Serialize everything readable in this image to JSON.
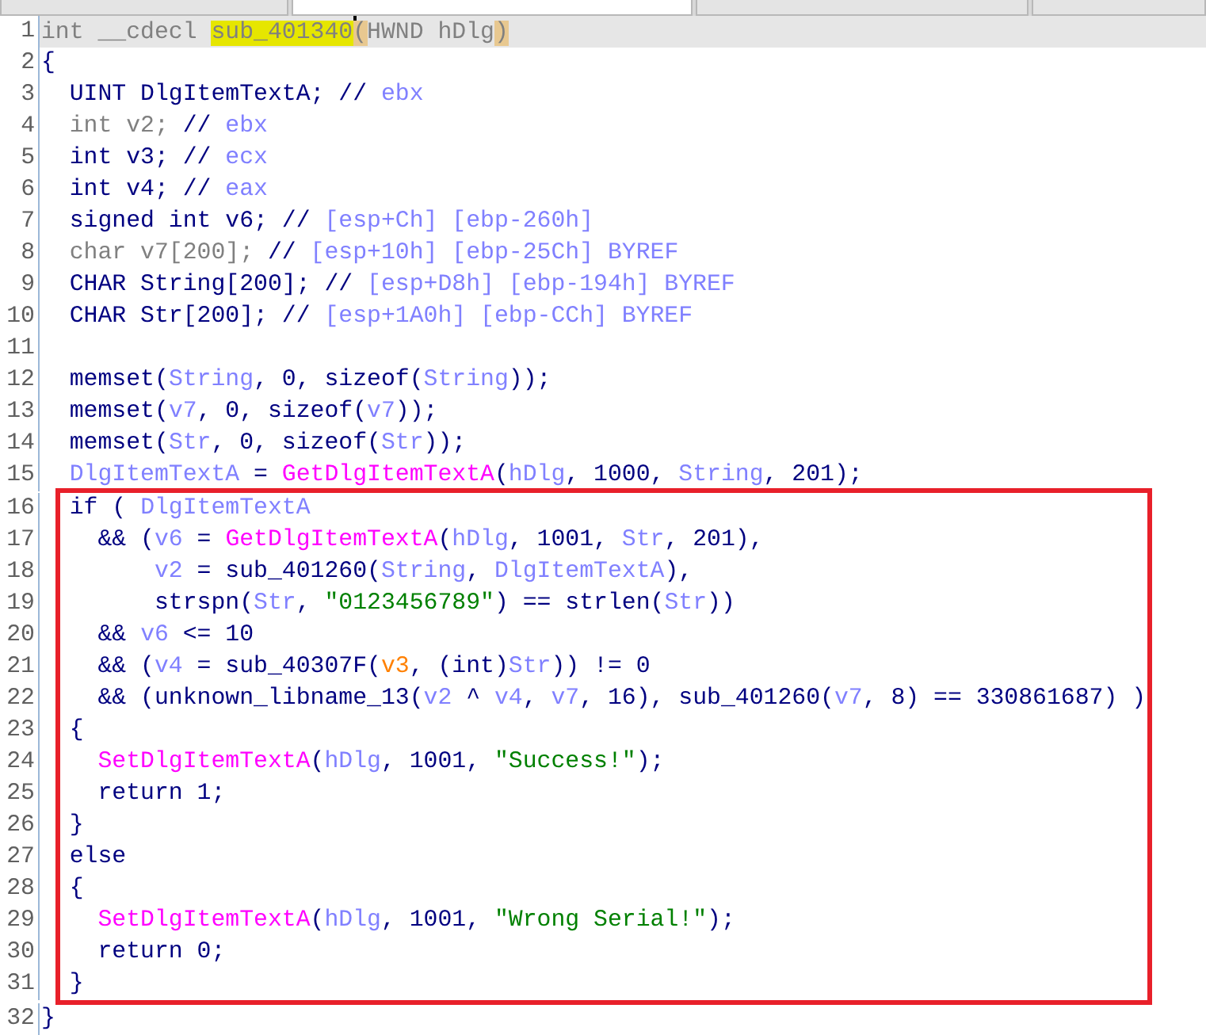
{
  "tabs": [
    {
      "selected": false
    },
    {
      "selected": true
    },
    {
      "selected": false
    },
    {
      "selected": false
    }
  ],
  "blocks": [
    {
      "boxed": false,
      "lines": [
        {
          "number": "1",
          "current": true,
          "tokens": [
            {
              "text": "int __cdecl ",
              "kind": "dim"
            },
            {
              "text": "sub_401340",
              "kind": "highlight",
              "cursor_after": true
            },
            {
              "text": "(",
              "kind": "match"
            },
            {
              "text": "HWND hDlg",
              "kind": "dim"
            },
            {
              "text": ")",
              "kind": "match"
            }
          ]
        },
        {
          "number": "2",
          "current": false,
          "tokens": [
            {
              "text": "{",
              "kind": "plain"
            }
          ]
        },
        {
          "number": "3",
          "current": false,
          "tokens": [
            {
              "text": "  UINT DlgItemTextA; // ",
              "kind": "plain"
            },
            {
              "text": "ebx",
              "kind": "var"
            }
          ]
        },
        {
          "number": "4",
          "current": false,
          "tokens": [
            {
              "text": "  int v2; ",
              "kind": "dim"
            },
            {
              "text": "// ",
              "kind": "plain"
            },
            {
              "text": "ebx",
              "kind": "var"
            }
          ]
        },
        {
          "number": "5",
          "current": false,
          "tokens": [
            {
              "text": "  int v3; // ",
              "kind": "plain"
            },
            {
              "text": "ecx",
              "kind": "var"
            }
          ]
        },
        {
          "number": "6",
          "current": false,
          "tokens": [
            {
              "text": "  int v4; // ",
              "kind": "plain"
            },
            {
              "text": "eax",
              "kind": "var"
            }
          ]
        },
        {
          "number": "7",
          "current": false,
          "tokens": [
            {
              "text": "  signed int v6; // ",
              "kind": "plain"
            },
            {
              "text": "[esp+Ch] [ebp-260h]",
              "kind": "var"
            }
          ]
        },
        {
          "number": "8",
          "current": false,
          "tokens": [
            {
              "text": "  char v7[200]; ",
              "kind": "dim"
            },
            {
              "text": "// ",
              "kind": "plain"
            },
            {
              "text": "[esp+10h] [ebp-25Ch] BYREF",
              "kind": "var"
            }
          ]
        },
        {
          "number": "9",
          "current": false,
          "tokens": [
            {
              "text": "  CHAR String[200]; // ",
              "kind": "plain"
            },
            {
              "text": "[esp+D8h] [ebp-194h] BYREF",
              "kind": "var"
            }
          ]
        },
        {
          "number": "10",
          "current": false,
          "tokens": [
            {
              "text": "  CHAR Str[200]; // ",
              "kind": "plain"
            },
            {
              "text": "[esp+1A0h] [ebp-CCh] BYREF",
              "kind": "var"
            }
          ]
        },
        {
          "number": "11",
          "current": false
        },
        {
          "number": "12",
          "current": false,
          "tokens": [
            {
              "text": "  memset(",
              "kind": "plain"
            },
            {
              "text": "String",
              "kind": "var"
            },
            {
              "text": ", 0, sizeof(",
              "kind": "plain"
            },
            {
              "text": "String",
              "kind": "var"
            },
            {
              "text": "));",
              "kind": "plain"
            }
          ]
        },
        {
          "number": "13",
          "current": false,
          "tokens": [
            {
              "text": "  memset(",
              "kind": "plain"
            },
            {
              "text": "v7",
              "kind": "var"
            },
            {
              "text": ", 0, sizeof(",
              "kind": "plain"
            },
            {
              "text": "v7",
              "kind": "var"
            },
            {
              "text": "));",
              "kind": "plain"
            }
          ]
        },
        {
          "number": "14",
          "current": false,
          "tokens": [
            {
              "text": "  memset(",
              "kind": "plain"
            },
            {
              "text": "Str",
              "kind": "var"
            },
            {
              "text": ", 0, sizeof(",
              "kind": "plain"
            },
            {
              "text": "Str",
              "kind": "var"
            },
            {
              "text": "));",
              "kind": "plain"
            }
          ]
        },
        {
          "number": "15",
          "current": false,
          "tokens": [
            {
              "text": "  DlgItemTextA",
              "kind": "var"
            },
            {
              "text": " = ",
              "kind": "plain"
            },
            {
              "text": "GetDlgItemTextA",
              "kind": "func"
            },
            {
              "text": "(",
              "kind": "plain"
            },
            {
              "text": "hDlg",
              "kind": "var"
            },
            {
              "text": ", 1000, ",
              "kind": "plain"
            },
            {
              "text": "String",
              "kind": "var"
            },
            {
              "text": ", 201);",
              "kind": "plain"
            }
          ]
        }
      ]
    },
    {
      "boxed": true,
      "lines": [
        {
          "number": "16",
          "current": false,
          "tokens": [
            {
              "text": "  if ( ",
              "kind": "plain"
            },
            {
              "text": "DlgItemTextA",
              "kind": "var"
            }
          ]
        },
        {
          "number": "17",
          "current": false,
          "tokens": [
            {
              "text": "    && (",
              "kind": "plain"
            },
            {
              "text": "v6",
              "kind": "var"
            },
            {
              "text": " = ",
              "kind": "plain"
            },
            {
              "text": "GetDlgItemTextA",
              "kind": "func"
            },
            {
              "text": "(",
              "kind": "plain"
            },
            {
              "text": "hDlg",
              "kind": "var"
            },
            {
              "text": ", 1001, ",
              "kind": "plain"
            },
            {
              "text": "Str",
              "kind": "var"
            },
            {
              "text": ", 201),",
              "kind": "plain"
            }
          ]
        },
        {
          "number": "18",
          "current": false,
          "tokens": [
            {
              "text": "        v2",
              "kind": "var"
            },
            {
              "text": " = sub_401260(",
              "kind": "plain"
            },
            {
              "text": "String",
              "kind": "var"
            },
            {
              "text": ", ",
              "kind": "plain"
            },
            {
              "text": "DlgItemTextA",
              "kind": "var"
            },
            {
              "text": "),",
              "kind": "plain"
            }
          ]
        },
        {
          "number": "19",
          "current": false,
          "tokens": [
            {
              "text": "        strspn(",
              "kind": "plain"
            },
            {
              "text": "Str",
              "kind": "var"
            },
            {
              "text": ", ",
              "kind": "plain"
            },
            {
              "text": "\"0123456789\"",
              "kind": "str"
            },
            {
              "text": ") == strlen(",
              "kind": "plain"
            },
            {
              "text": "Str",
              "kind": "var"
            },
            {
              "text": "))",
              "kind": "plain"
            }
          ]
        },
        {
          "number": "20",
          "current": false,
          "tokens": [
            {
              "text": "    && ",
              "kind": "plain"
            },
            {
              "text": "v6",
              "kind": "var"
            },
            {
              "text": " <= 10",
              "kind": "plain"
            }
          ]
        },
        {
          "number": "21",
          "current": false,
          "tokens": [
            {
              "text": "    && (",
              "kind": "plain"
            },
            {
              "text": "v4",
              "kind": "var"
            },
            {
              "text": " = sub_40307F(",
              "kind": "plain"
            },
            {
              "text": "v3",
              "kind": "orange"
            },
            {
              "text": ", (int)",
              "kind": "plain"
            },
            {
              "text": "Str",
              "kind": "var"
            },
            {
              "text": ")) != 0",
              "kind": "plain"
            }
          ]
        },
        {
          "number": "22",
          "current": false,
          "tokens": [
            {
              "text": "    && (unknown_libname_13(",
              "kind": "plain"
            },
            {
              "text": "v2",
              "kind": "var"
            },
            {
              "text": " ^ ",
              "kind": "plain"
            },
            {
              "text": "v4",
              "kind": "var"
            },
            {
              "text": ", ",
              "kind": "plain"
            },
            {
              "text": "v7",
              "kind": "var"
            },
            {
              "text": ", 16), sub_401260(",
              "kind": "plain"
            },
            {
              "text": "v7",
              "kind": "var"
            },
            {
              "text": ", 8) == 330861687) )",
              "kind": "plain"
            }
          ]
        },
        {
          "number": "23",
          "current": false,
          "tokens": [
            {
              "text": "  {",
              "kind": "plain"
            }
          ]
        },
        {
          "number": "24",
          "current": false,
          "tokens": [
            {
              "text": "    SetDlgItemTextA",
              "kind": "func"
            },
            {
              "text": "(",
              "kind": "plain"
            },
            {
              "text": "hDlg",
              "kind": "var"
            },
            {
              "text": ", 1001, ",
              "kind": "plain"
            },
            {
              "text": "\"Success!\"",
              "kind": "str"
            },
            {
              "text": ");",
              "kind": "plain"
            }
          ]
        },
        {
          "number": "25",
          "current": false,
          "tokens": [
            {
              "text": "    return 1;",
              "kind": "plain"
            }
          ]
        },
        {
          "number": "26",
          "current": false,
          "tokens": [
            {
              "text": "  }",
              "kind": "plain"
            }
          ]
        },
        {
          "number": "27",
          "current": false,
          "tokens": [
            {
              "text": "  else",
              "kind": "plain"
            }
          ]
        },
        {
          "number": "28",
          "current": false,
          "tokens": [
            {
              "text": "  {",
              "kind": "plain"
            }
          ]
        },
        {
          "number": "29",
          "current": false,
          "tokens": [
            {
              "text": "    SetDlgItemTextA",
              "kind": "func"
            },
            {
              "text": "(",
              "kind": "plain"
            },
            {
              "text": "hDlg",
              "kind": "var"
            },
            {
              "text": ", 1001, ",
              "kind": "plain"
            },
            {
              "text": "\"Wrong Serial!\"",
              "kind": "str"
            },
            {
              "text": ");",
              "kind": "plain"
            }
          ]
        },
        {
          "number": "30",
          "current": false,
          "tokens": [
            {
              "text": "    return 0;",
              "kind": "plain"
            }
          ]
        },
        {
          "number": "31",
          "current": false,
          "tokens": [
            {
              "text": "  }",
              "kind": "plain"
            }
          ]
        }
      ]
    },
    {
      "boxed": false,
      "lines": [
        {
          "number": "32",
          "current": false,
          "tokens": [
            {
              "text": "}",
              "kind": "plain"
            }
          ]
        }
      ]
    }
  ]
}
